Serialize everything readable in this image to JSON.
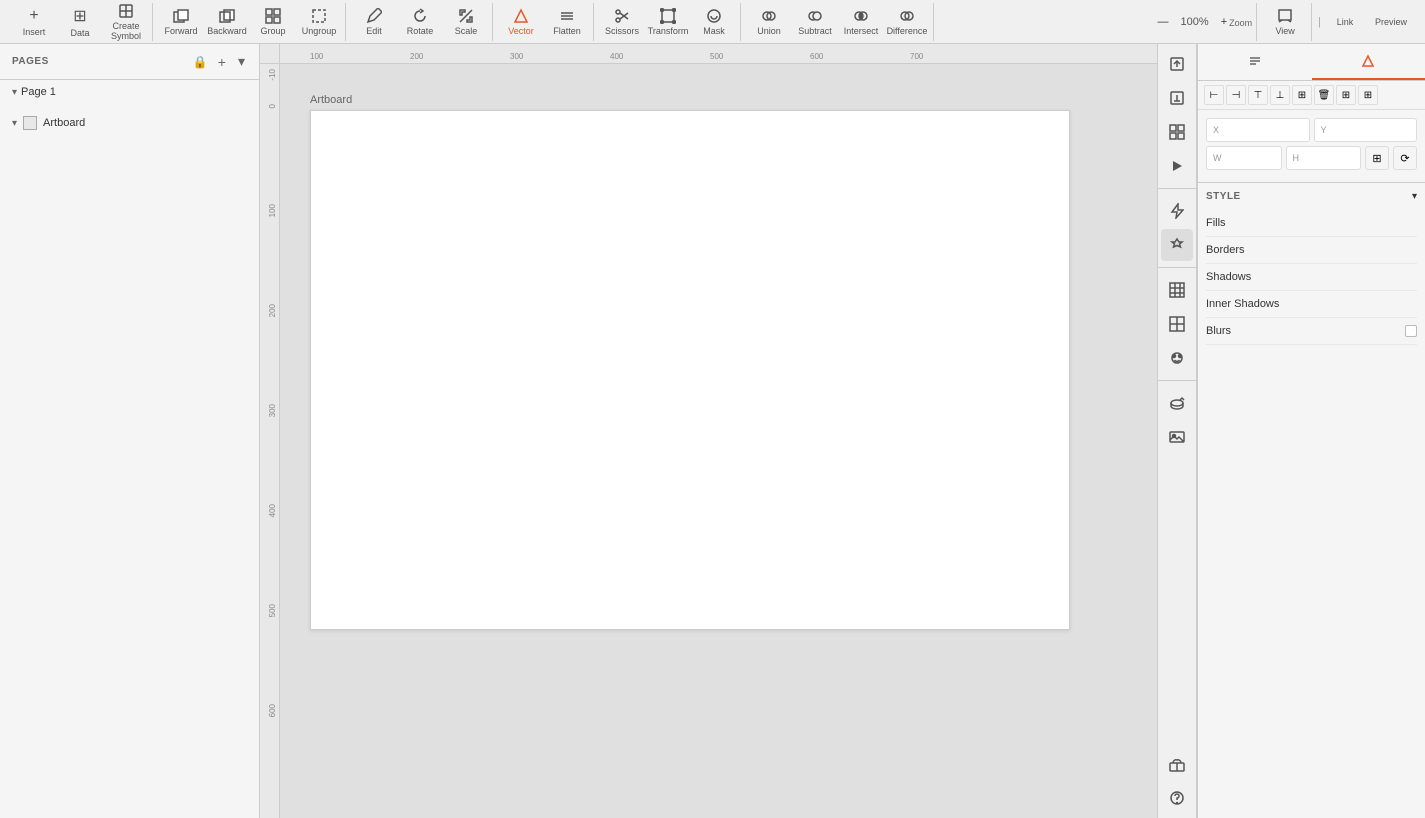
{
  "toolbar": {
    "insert_label": "Insert",
    "data_label": "Data",
    "create_symbol_label": "Create Symbol",
    "forward_label": "Forward",
    "backward_label": "Backward",
    "group_label": "Group",
    "ungroup_label": "Ungroup",
    "edit_label": "Edit",
    "rotate_label": "Rotate",
    "scale_label": "Scale",
    "vector_label": "Vector",
    "flatten_label": "Flatten",
    "scissors_label": "Scissors",
    "transform_label": "Transform",
    "mask_label": "Mask",
    "union_label": "Union",
    "subtract_label": "Subtract",
    "intersect_label": "Intersect",
    "difference_label": "Difference",
    "zoom_label": "Zoom",
    "zoom_value": "100%",
    "view_label": "View",
    "link_label": "Link",
    "preview_label": "Preview"
  },
  "pages": {
    "section_label": "PAGES",
    "add_label": "+",
    "dropdown_label": "▾",
    "lock_icon": "🔒",
    "items": [
      {
        "name": "Page 1",
        "chevron": "▾"
      }
    ]
  },
  "layers": {
    "items": [
      {
        "name": "Artboard",
        "type": "artboard",
        "chevron": "▾"
      }
    ]
  },
  "canvas": {
    "artboard_label": "Artboard",
    "ruler_ticks_h": [
      "100",
      "200",
      "300",
      "400",
      "500",
      "600",
      "700"
    ],
    "ruler_ticks_v": [
      "-10",
      "0",
      "100",
      "200",
      "300",
      "400",
      "500",
      "600"
    ]
  },
  "right_icon_bar": {
    "icons": [
      {
        "name": "upload-icon",
        "glyph": "↑",
        "title": "Upload"
      },
      {
        "name": "export-icon",
        "glyph": "⬆",
        "title": "Export"
      },
      {
        "name": "fit-icon",
        "glyph": "⊞",
        "title": "Fit"
      },
      {
        "name": "play-icon",
        "glyph": "▶",
        "title": "Play"
      },
      {
        "name": "lightning-icon",
        "glyph": "⚡",
        "title": "Lightning"
      },
      {
        "name": "hexagon-icon",
        "glyph": "⬡",
        "title": "Components"
      },
      {
        "name": "grid-icon",
        "glyph": "⊞",
        "title": "Grid"
      },
      {
        "name": "grid2-icon",
        "glyph": "⊟",
        "title": "Grid 2"
      },
      {
        "name": "paint-icon",
        "glyph": "🎨",
        "title": "Paint"
      },
      {
        "name": "rotate3d-icon",
        "glyph": "↻",
        "title": "Rotate 3D"
      },
      {
        "name": "image-icon",
        "glyph": "🖼",
        "title": "Image"
      },
      {
        "name": "gift-icon",
        "glyph": "🎁",
        "title": "Gift"
      },
      {
        "name": "help-icon",
        "glyph": "?",
        "title": "Help"
      }
    ]
  },
  "right_panel": {
    "tab_style": "Style",
    "tab_other": "◎",
    "coords": {
      "x_label": "X",
      "x_value": "",
      "y_label": "Y",
      "y_value": "",
      "w_label": "W",
      "w_value": "",
      "h_label": "H",
      "h_value": ""
    },
    "style_section": {
      "title": "STYLE",
      "dropdown": "▾",
      "rows": [
        {
          "label": "Fills",
          "has_checkbox": false
        },
        {
          "label": "Borders",
          "has_checkbox": false
        },
        {
          "label": "Shadows",
          "has_checkbox": false
        },
        {
          "label": "Inner Shadows",
          "has_checkbox": false
        },
        {
          "label": "Blurs",
          "has_checkbox": true
        }
      ]
    },
    "transform_icons": [
      "⊢",
      "⊣",
      "⊤",
      "⊥",
      "⊞",
      "🗑",
      "⊞",
      "⊞"
    ],
    "ratio_icons": [
      "⊞",
      "📐"
    ]
  }
}
